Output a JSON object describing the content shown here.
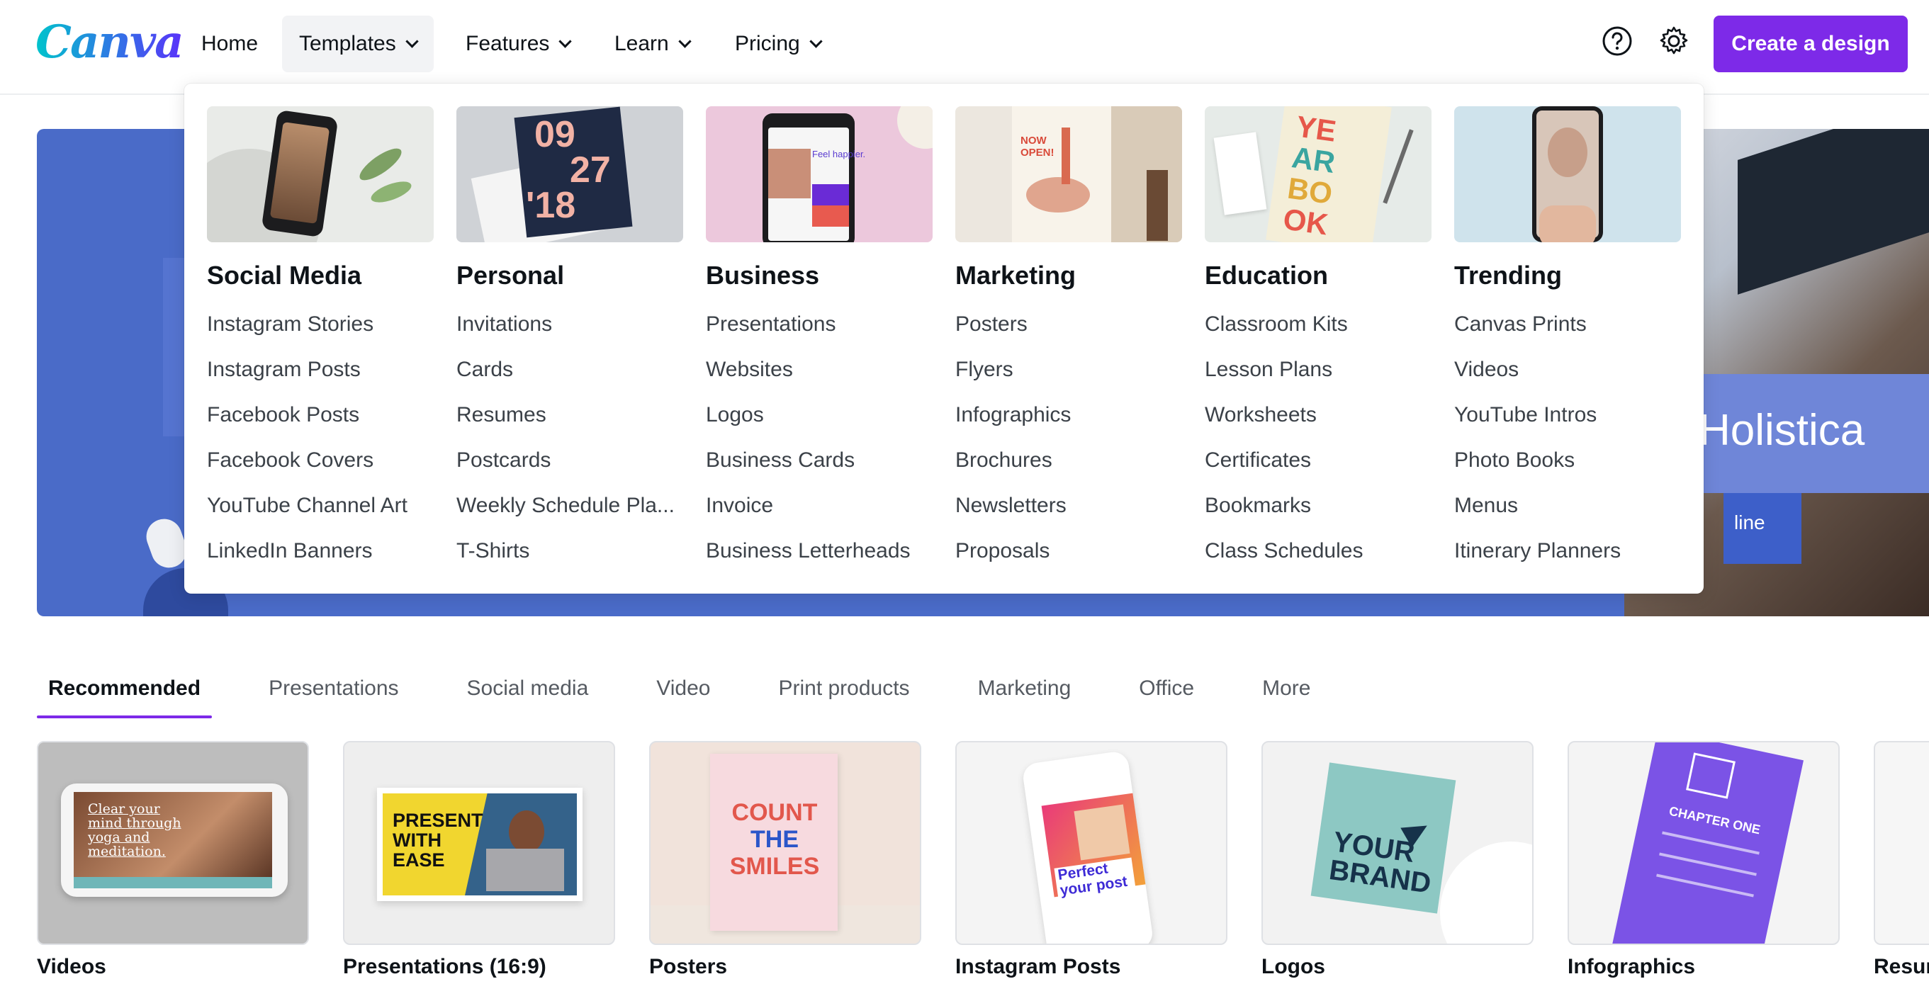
{
  "brand": {
    "logo": "Canva",
    "accent": "#7d2ae8"
  },
  "nav": {
    "items": [
      {
        "label": "Home",
        "dropdown": false
      },
      {
        "label": "Templates",
        "dropdown": true,
        "active": true
      },
      {
        "label": "Features",
        "dropdown": true
      },
      {
        "label": "Learn",
        "dropdown": true
      },
      {
        "label": "Pricing",
        "dropdown": true
      }
    ],
    "help_icon": "help-circle-icon",
    "settings_icon": "gear-icon",
    "cta": "Create a design"
  },
  "hero": {
    "brand_text": "Holistica",
    "chip_text": "line"
  },
  "mega_menu": {
    "columns": [
      {
        "title": "Social Media",
        "links": [
          "Instagram Stories",
          "Instagram Posts",
          "Facebook Posts",
          "Facebook Covers",
          "YouTube Channel Art",
          "LinkedIn Banners"
        ]
      },
      {
        "title": "Personal",
        "links": [
          "Invitations",
          "Cards",
          "Resumes",
          "Postcards",
          "Weekly Schedule Pla...",
          "T-Shirts"
        ]
      },
      {
        "title": "Business",
        "links": [
          "Presentations",
          "Websites",
          "Logos",
          "Business Cards",
          "Invoice",
          "Business Letterheads"
        ]
      },
      {
        "title": "Marketing",
        "links": [
          "Posters",
          "Flyers",
          "Infographics",
          "Brochures",
          "Newsletters",
          "Proposals"
        ]
      },
      {
        "title": "Education",
        "links": [
          "Classroom Kits",
          "Lesson Plans",
          "Worksheets",
          "Certificates",
          "Bookmarks",
          "Class Schedules"
        ]
      },
      {
        "title": "Trending",
        "links": [
          "Canvas Prints",
          "Videos",
          "YouTube Intros",
          "Photo Books",
          "Menus",
          "Itinerary Planners"
        ]
      }
    ],
    "thumb_text": {
      "personal_a": "09",
      "personal_b": "27",
      "personal_c": "'18",
      "business": "Feel happier.",
      "marketing": "NOW OPEN!",
      "education": [
        "YE",
        "AR",
        "BO",
        "OK"
      ]
    }
  },
  "tabs": [
    {
      "label": "Recommended",
      "active": true
    },
    {
      "label": "Presentations"
    },
    {
      "label": "Social media"
    },
    {
      "label": "Video"
    },
    {
      "label": "Print products"
    },
    {
      "label": "Marketing"
    },
    {
      "label": "Office"
    },
    {
      "label": "More"
    }
  ],
  "cards": [
    {
      "label": "Videos",
      "thumb": "Clear your mind through yoga and meditation."
    },
    {
      "label": "Presentations (16:9)",
      "thumb": "PRESENT WITH EASE"
    },
    {
      "label": "Posters",
      "thumb": [
        "COUNT",
        "THE",
        "SMILES"
      ]
    },
    {
      "label": "Instagram Posts",
      "thumb": "Perfect your post"
    },
    {
      "label": "Logos",
      "thumb": [
        "YOUR",
        "BRAND"
      ]
    },
    {
      "label": "Infographics",
      "thumb": "CHAPTER ONE"
    },
    {
      "label": "Resum"
    }
  ]
}
